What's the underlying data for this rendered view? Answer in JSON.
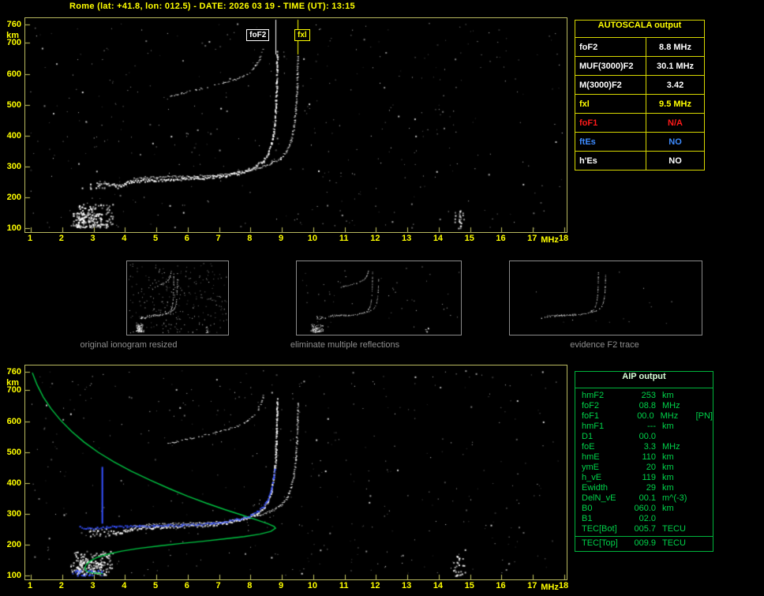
{
  "title": "Rome (lat: +41.8, lon: 012.5) - DATE: 2026 03 19 - TIME (UT): 13:15",
  "colors": {
    "white": "#ffffff",
    "yellow": "#ffff00",
    "red": "#ff1a1a",
    "blue": "#3d8bff",
    "trace_blue": "#3550ff",
    "profile_green": "#00cc44",
    "plot_border": "#b9b95f",
    "tick": "#c8c860",
    "table_border_yellow": "#d8d800",
    "aip_border": "#00b43c",
    "caption_gray": "#8f8f8f"
  },
  "autoscala_table": {
    "header": "AUTOSCALA output",
    "rows": [
      {
        "label": "foF2",
        "value": "8.8 MHz",
        "color": "white"
      },
      {
        "label": "MUF(3000)F2",
        "value": "30.1 MHz",
        "color": "white"
      },
      {
        "label": "M(3000)F2",
        "value": "3.42",
        "color": "white"
      },
      {
        "label": "fxl",
        "value": "9.5 MHz",
        "color": "yellow"
      },
      {
        "label": "foF1",
        "value": "N/A",
        "color": "red"
      },
      {
        "label": "ftEs",
        "value": "NO",
        "color": "blue"
      },
      {
        "label": "h'Es",
        "value": "NO",
        "color": "white"
      }
    ]
  },
  "aip_table": {
    "header": "AIP output",
    "rows": [
      {
        "label": "hmF2",
        "value": "253",
        "unit": "km",
        "note": ""
      },
      {
        "label": "foF2",
        "value": "08.8",
        "unit": "MHz",
        "note": ""
      },
      {
        "label": "foF1",
        "value": "00.0",
        "unit": "MHz",
        "note": "[PN]"
      },
      {
        "label": "hmF1",
        "value": "---",
        "unit": "km",
        "note": ""
      },
      {
        "label": "D1",
        "value": "00.0",
        "unit": "",
        "note": ""
      },
      {
        "label": "foE",
        "value": "3.3",
        "unit": "MHz",
        "note": ""
      },
      {
        "label": "hmE",
        "value": "110",
        "unit": "km",
        "note": ""
      },
      {
        "label": "ymE",
        "value": "20",
        "unit": "km",
        "note": ""
      },
      {
        "label": "h_vE",
        "value": "119",
        "unit": "km",
        "note": ""
      },
      {
        "label": "Ewidth",
        "value": "29",
        "unit": "km",
        "note": ""
      },
      {
        "label": "DelN_vE",
        "value": "00.1",
        "unit": "m^(-3)",
        "note": ""
      },
      {
        "label": "B0",
        "value": "060.0",
        "unit": "km",
        "note": ""
      },
      {
        "label": "B1",
        "value": "02.0",
        "unit": "",
        "note": ""
      },
      {
        "label": "TEC[Bot]",
        "value": "005.7",
        "unit": "TECU",
        "note": ""
      },
      {
        "label": "TEC[Top]",
        "value": "009.9",
        "unit": "TECU",
        "note": "",
        "divider": true
      }
    ]
  },
  "thumbnails": [
    {
      "caption": "original ionogram resized",
      "noise": 260,
      "seed": 31,
      "traces": "all"
    },
    {
      "caption": "eliminate multiple reflections",
      "noise": 45,
      "seed": 32,
      "traces": "all"
    },
    {
      "caption": "evidence F2 trace",
      "noise": 14,
      "seed": 33,
      "traces": "f2-only"
    }
  ],
  "chart_data": [
    {
      "name": "ionogram-top",
      "type": "scatter",
      "title": "",
      "xlabel": "MHz",
      "ylabel": "km",
      "xlim": [
        1,
        18
      ],
      "ylim": [
        100,
        760
      ],
      "x_ticks": [
        1,
        2,
        3,
        4,
        5,
        6,
        7,
        8,
        9,
        10,
        11,
        12,
        13,
        14,
        15,
        16,
        17,
        18
      ],
      "y_ticks": [
        760,
        700,
        600,
        500,
        400,
        300,
        200,
        100
      ],
      "grid": false,
      "markers": [
        {
          "label": "foF2",
          "f": 8.8,
          "color": "#ffffff"
        },
        {
          "label": "fxl",
          "f": 9.5,
          "color": "#ffff00"
        }
      ],
      "traces": [
        {
          "name": "F2-ordinary-trace",
          "color": "#ffffff",
          "width": 4,
          "dotted": false,
          "points": [
            [
              3.55,
              244
            ],
            [
              3.7,
              238
            ],
            [
              3.85,
              240
            ],
            [
              4.0,
              247
            ],
            [
              4.2,
              252
            ],
            [
              4.5,
              255
            ],
            [
              4.9,
              257
            ],
            [
              5.3,
              259
            ],
            [
              5.8,
              261
            ],
            [
              6.3,
              263
            ],
            [
              6.8,
              267
            ],
            [
              7.2,
              272
            ],
            [
              7.6,
              280
            ],
            [
              7.95,
              291
            ],
            [
              8.2,
              304
            ],
            [
              8.4,
              320
            ],
            [
              8.55,
              344
            ],
            [
              8.65,
              374
            ],
            [
              8.72,
              412
            ],
            [
              8.77,
              458
            ],
            [
              8.8,
              512
            ],
            [
              8.82,
              570
            ],
            [
              8.83,
              628
            ],
            [
              8.84,
              672
            ]
          ]
        },
        {
          "name": "F2-extraordinary-trace",
          "color": "#ffffff",
          "width": 3,
          "dotted": false,
          "points": [
            [
              4.25,
              260
            ],
            [
              4.6,
              264
            ],
            [
              5.0,
              266
            ],
            [
              5.5,
              268
            ],
            [
              6.0,
              269
            ],
            [
              6.5,
              271
            ],
            [
              7.0,
              274
            ],
            [
              7.45,
              279
            ],
            [
              7.9,
              287
            ],
            [
              8.3,
              297
            ],
            [
              8.65,
              310
            ],
            [
              8.95,
              328
            ],
            [
              9.15,
              352
            ],
            [
              9.28,
              386
            ],
            [
              9.37,
              430
            ],
            [
              9.43,
              482
            ],
            [
              9.46,
              540
            ],
            [
              9.48,
              602
            ],
            [
              9.49,
              660
            ]
          ]
        },
        {
          "name": "second-hop-trace",
          "color": "#ffffff",
          "width": 2,
          "dotted": true,
          "points": [
            [
              5.35,
              528
            ],
            [
              5.8,
              538
            ],
            [
              6.25,
              549
            ],
            [
              6.7,
              560
            ],
            [
              7.15,
              571
            ],
            [
              7.5,
              583
            ],
            [
              7.8,
              597
            ],
            [
              8.05,
              615
            ],
            [
              8.22,
              638
            ],
            [
              8.33,
              662
            ],
            [
              8.4,
              684
            ]
          ]
        }
      ],
      "scatter_regions": [
        {
          "name": "E-region-echoes",
          "f": [
            2.25,
            3.6
          ],
          "h": [
            103,
            180
          ],
          "count": 130
        },
        {
          "name": "E-region-core",
          "f": [
            2.45,
            3.25
          ],
          "h": [
            104,
            150
          ],
          "count": 85
        },
        {
          "name": "trace-leading-dots",
          "f": [
            2.85,
            3.5
          ],
          "h": [
            228,
            254
          ],
          "count": 25
        },
        {
          "name": "interference-streak",
          "f": [
            14.45,
            14.8
          ],
          "h": [
            100,
            165
          ],
          "count": 26
        }
      ],
      "noise": {
        "seed": 7,
        "count": 430
      }
    },
    {
      "name": "ionogram-bottom-with-profile",
      "type": "scatter",
      "title": "",
      "xlabel": "MHz",
      "ylabel": "km",
      "xlim": [
        1,
        18
      ],
      "ylim": [
        100,
        760
      ],
      "x_ticks": [
        1,
        2,
        3,
        4,
        5,
        6,
        7,
        8,
        9,
        10,
        11,
        12,
        13,
        14,
        15,
        16,
        17,
        18
      ],
      "y_ticks": [
        760,
        700,
        600,
        500,
        400,
        300,
        200,
        100
      ],
      "grid": false,
      "white_traces": "same-as-top-chart",
      "scatter_regions": [
        {
          "name": "E-region-echoes",
          "f": [
            2.25,
            3.6
          ],
          "h": [
            103,
            180
          ],
          "count": 130
        },
        {
          "name": "E-region-core",
          "f": [
            2.45,
            3.25
          ],
          "h": [
            104,
            150
          ],
          "count": 85
        },
        {
          "name": "trace-leading-dots",
          "f": [
            2.85,
            3.5
          ],
          "h": [
            228,
            254
          ],
          "count": 25
        },
        {
          "name": "interference-streak",
          "f": [
            14.45,
            14.8
          ],
          "h": [
            100,
            165
          ],
          "count": 26
        }
      ],
      "profile": {
        "name": "electron-density-profile",
        "color": "#00cc44",
        "points": [
          [
            1.05,
            757
          ],
          [
            1.2,
            718
          ],
          [
            1.4,
            678
          ],
          [
            1.65,
            640
          ],
          [
            1.95,
            603
          ],
          [
            2.3,
            567
          ],
          [
            2.7,
            532
          ],
          [
            3.15,
            499
          ],
          [
            3.65,
            468
          ],
          [
            4.2,
            438
          ],
          [
            4.8,
            409
          ],
          [
            5.4,
            382
          ],
          [
            6.0,
            357
          ],
          [
            6.6,
            334
          ],
          [
            7.2,
            313
          ],
          [
            7.75,
            295
          ],
          [
            8.2,
            280
          ],
          [
            8.55,
            268
          ],
          [
            8.75,
            259
          ],
          [
            8.8,
            253
          ],
          [
            8.65,
            243
          ],
          [
            8.3,
            234
          ],
          [
            7.8,
            226
          ],
          [
            7.2,
            219
          ],
          [
            6.5,
            211
          ],
          [
            5.8,
            204
          ],
          [
            5.1,
            196
          ],
          [
            4.45,
            188
          ],
          [
            3.9,
            179
          ],
          [
            3.45,
            169
          ],
          [
            3.1,
            158
          ],
          [
            2.88,
            146
          ],
          [
            2.76,
            134
          ],
          [
            2.72,
            123
          ],
          [
            2.78,
            114
          ],
          [
            2.95,
            109
          ],
          [
            3.15,
            107
          ],
          [
            3.3,
            106
          ]
        ]
      },
      "autoscaled_trace": {
        "name": "autoscaled-F2-trace",
        "color": "#3550ff",
        "points": [
          [
            2.55,
            258
          ],
          [
            2.8,
            254
          ],
          [
            3.1,
            255
          ],
          [
            3.4,
            258
          ],
          [
            3.7,
            260
          ],
          [
            4.05,
            261
          ],
          [
            4.45,
            262
          ],
          [
            4.9,
            263
          ],
          [
            5.35,
            264
          ],
          [
            5.8,
            265
          ],
          [
            6.3,
            267
          ],
          [
            6.75,
            271
          ],
          [
            7.2,
            276
          ],
          [
            7.6,
            284
          ],
          [
            7.95,
            295
          ],
          [
            8.2,
            308
          ],
          [
            8.4,
            325
          ],
          [
            8.55,
            350
          ],
          [
            8.65,
            382
          ],
          [
            8.72,
            418
          ],
          [
            8.76,
            448
          ]
        ]
      },
      "valley_line": {
        "name": "E-valley-line",
        "color": "#3550ff",
        "f": 3.28,
        "h_from": 268,
        "h_to": 452
      },
      "e_trace_dots": {
        "name": "E-trace-dots",
        "color": "#3550ff",
        "f": [
          2.3,
          3.25
        ],
        "h": [
          100,
          118
        ],
        "count": 35
      },
      "noise": {
        "seed": 13,
        "count": 430
      }
    }
  ]
}
